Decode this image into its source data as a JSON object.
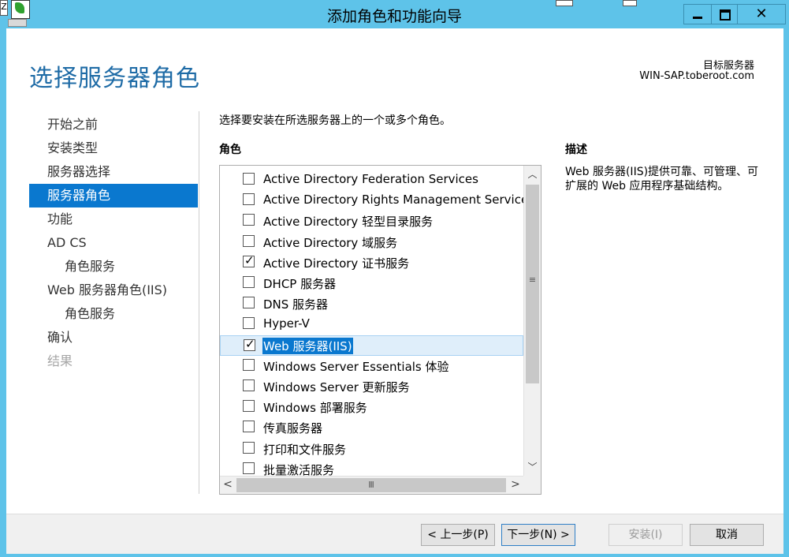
{
  "window": {
    "title": "添加角色和功能向导",
    "close_glyph": "✕",
    "ghost_char": "Z"
  },
  "header": {
    "page_title": "选择服务器角色",
    "target_label": "目标服务器",
    "target_server": "WIN-SAP.toberoot.com"
  },
  "nav": {
    "items": [
      {
        "label": "开始之前",
        "state": "normal"
      },
      {
        "label": "安装类型",
        "state": "normal"
      },
      {
        "label": "服务器选择",
        "state": "normal"
      },
      {
        "label": "服务器角色",
        "state": "active"
      },
      {
        "label": "功能",
        "state": "normal"
      },
      {
        "label": "AD CS",
        "state": "normal"
      },
      {
        "label": "角色服务",
        "state": "sub"
      },
      {
        "label": "Web 服务器角色(IIS)",
        "state": "normal"
      },
      {
        "label": "角色服务",
        "state": "sub"
      },
      {
        "label": "确认",
        "state": "normal"
      },
      {
        "label": "结果",
        "state": "disabled"
      }
    ]
  },
  "main": {
    "instruction": "选择要安装在所选服务器上的一个或多个角色。",
    "roles_header": "角色",
    "roles": [
      {
        "label": "Active Directory Federation Services",
        "checked": false
      },
      {
        "label": "Active Directory Rights Management Services",
        "checked": false
      },
      {
        "label": "Active Directory 轻型目录服务",
        "checked": false
      },
      {
        "label": "Active Directory 域服务",
        "checked": false
      },
      {
        "label": "Active Directory 证书服务",
        "checked": true
      },
      {
        "label": "DHCP 服务器",
        "checked": false
      },
      {
        "label": "DNS 服务器",
        "checked": false
      },
      {
        "label": "Hyper-V",
        "checked": false
      },
      {
        "label": "Web 服务器(IIS)",
        "checked": true,
        "selected": true
      },
      {
        "label": "Windows Server Essentials 体验",
        "checked": false
      },
      {
        "label": "Windows Server 更新服务",
        "checked": false
      },
      {
        "label": "Windows 部署服务",
        "checked": false
      },
      {
        "label": "传真服务器",
        "checked": false
      },
      {
        "label": "打印和文件服务",
        "checked": false
      },
      {
        "label": "批量激活服务",
        "checked": false
      }
    ],
    "check_glyph": "✓",
    "scroll": {
      "up": "︿",
      "down": "﹀",
      "left": "<",
      "right": ">",
      "grip_v": "≡",
      "grip_h": "Ⅲ"
    },
    "description_header": "描述",
    "description_text": "Web 服务器(IIS)提供可靠、可管理、可扩展的 Web 应用程序基础结构。"
  },
  "footer": {
    "prev": "< 上一步(P)",
    "next": "下一步(N) >",
    "install": "安装(I)",
    "cancel": "取消"
  },
  "colors": {
    "titlebar": "#5ec3e9",
    "accent": "#0a78cf",
    "page_title": "#1e6ba6"
  }
}
